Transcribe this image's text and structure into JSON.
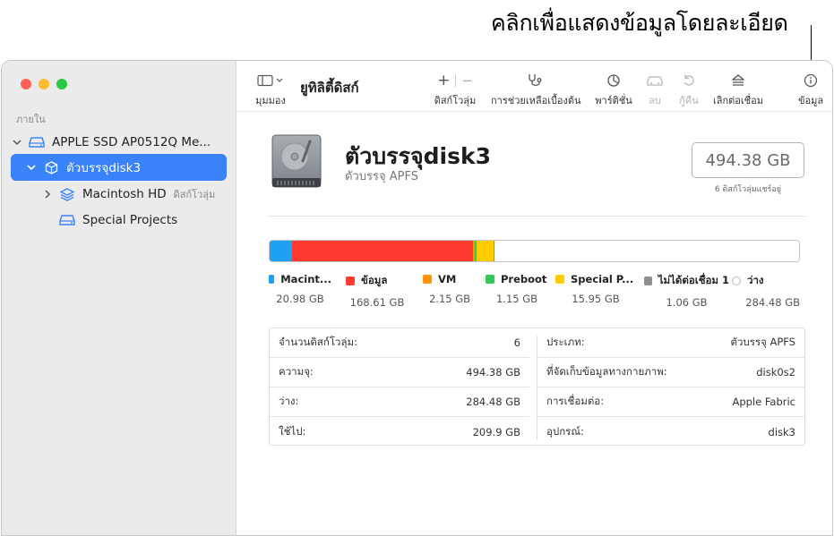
{
  "callout": "คลิกเพื่อแสดงข้อมูลโดยละเอียด",
  "sidebar": {
    "section": "ภายใน",
    "items": [
      {
        "label": "APPLE SSD AP0512Q Me...",
        "sub": ""
      },
      {
        "label": "ตัวบรรจุdisk3",
        "sub": ""
      },
      {
        "label": "Macintosh HD",
        "sub": "ดิสก์โวลุ่ม"
      },
      {
        "label": "Special Projects",
        "sub": ""
      }
    ]
  },
  "toolbar": {
    "view_label": "มุมมอง",
    "title": "ยูทิลิตี้ดิสก์",
    "volume_label": "ดิสก์โวลุ่ม",
    "firstaid_label": "การช่วยเหลือเบื้องต้น",
    "partition_label": "พาร์ติชั่น",
    "erase_label": "ลบ",
    "restore_label": "กู้คืน",
    "unmount_label": "เลิกต่อเชื่อม",
    "info_label": "ข้อมูล",
    "plus": "+",
    "minus": "−"
  },
  "volume": {
    "name": "ตัวบรรจุdisk3",
    "type": "ตัวบรรจุ APFS",
    "capacity": "494.38 GB",
    "shared": "6 ดิสก์โวลุ่มแชร์อยู่"
  },
  "usage": {
    "segments": [
      {
        "name": "Macint...",
        "size": "20.98 GB",
        "gb": 20.98,
        "color": "#1ea1f2"
      },
      {
        "name": "ข้อมูล",
        "size": "168.61 GB",
        "gb": 168.61,
        "color": "#ff3b30"
      },
      {
        "name": "VM",
        "size": "2.15 GB",
        "gb": 2.15,
        "color": "#ff9500"
      },
      {
        "name": "Preboot",
        "size": "1.15 GB",
        "gb": 1.15,
        "color": "#34c759"
      },
      {
        "name": "Special P...",
        "size": "15.95 GB",
        "gb": 15.95,
        "color": "#ffcc00"
      },
      {
        "name": "ไม่ได้ต่อเชื่อม 1",
        "size": "1.06 GB",
        "gb": 1.06,
        "color": "#8e8e8e"
      },
      {
        "name": "ว่าง",
        "size": "284.48 GB",
        "gb": 284.48,
        "color": "#ffffff"
      }
    ]
  },
  "info": {
    "left": [
      {
        "label": "จำนวนดิสก์โวลุ่ม:",
        "value": "6"
      },
      {
        "label": "ความจุ:",
        "value": "494.38 GB"
      },
      {
        "label": "ว่าง:",
        "value": "284.48 GB"
      },
      {
        "label": "ใช้ไป:",
        "value": "209.9 GB"
      }
    ],
    "right": [
      {
        "label": "ประเภท:",
        "value": "ตัวบรรจุ APFS"
      },
      {
        "label": "ที่จัดเก็บข้อมูลทางกายภาพ:",
        "value": "disk0s2"
      },
      {
        "label": "การเชื่อมต่อ:",
        "value": "Apple Fabric"
      },
      {
        "label": "อุปกรณ์:",
        "value": "disk3"
      }
    ]
  }
}
